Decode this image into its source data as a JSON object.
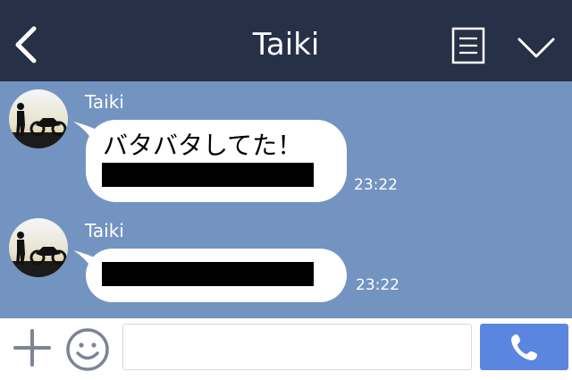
{
  "header": {
    "title": "Taiki",
    "back_icon": "chevron-left-icon",
    "notes_icon": "notes-icon",
    "menu_icon": "chevron-down-icon"
  },
  "messages": [
    {
      "sender": "Taiki",
      "text": "バタバタしてた！",
      "time": "23:22"
    },
    {
      "sender": "Taiki",
      "text": "",
      "time": "23:22"
    }
  ],
  "input": {
    "placeholder": "",
    "plus_icon": "plus-icon",
    "emoji_icon": "smiley-icon",
    "call_icon": "phone-icon"
  },
  "colors": {
    "header_bg": "#263046",
    "chat_bg": "#7394c1",
    "call_button": "#5b86df"
  }
}
